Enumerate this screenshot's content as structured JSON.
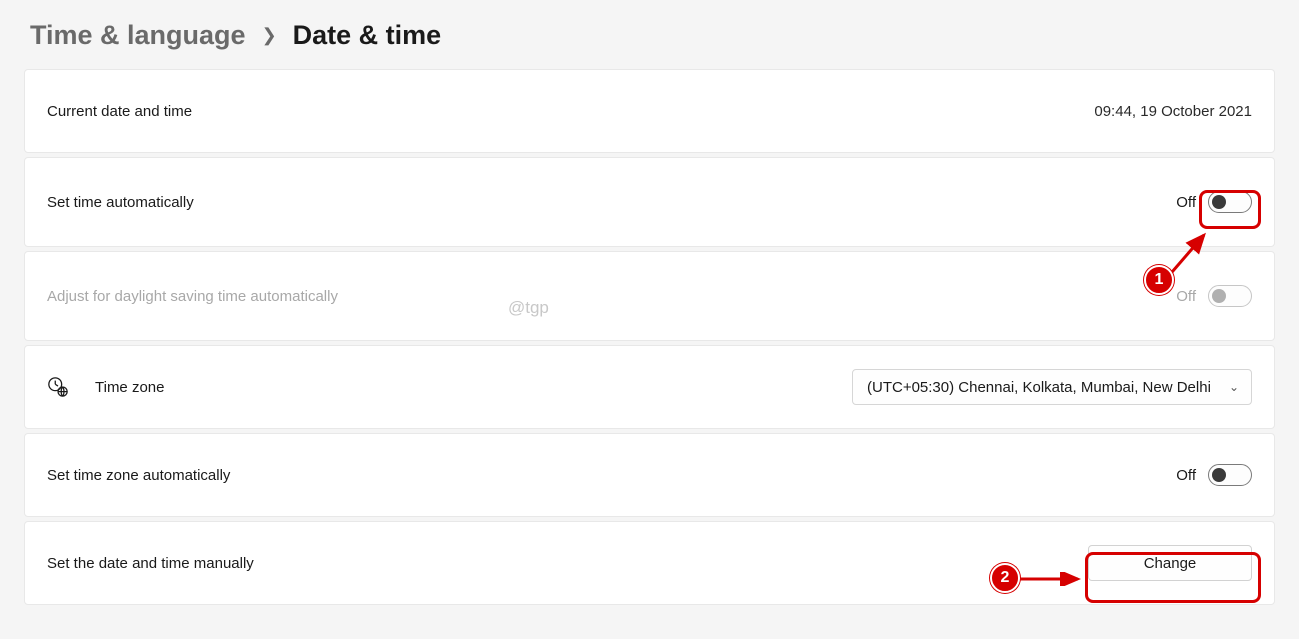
{
  "breadcrumb": {
    "parent": "Time & language",
    "current": "Date & time"
  },
  "rows": {
    "current": {
      "label": "Current date and time",
      "value": "09:44, 19 October 2021"
    },
    "autoTime": {
      "label": "Set time automatically",
      "state": "Off"
    },
    "dst": {
      "label": "Adjust for daylight saving time automatically",
      "state": "Off"
    },
    "timezone": {
      "label": "Time zone",
      "value": "(UTC+05:30) Chennai, Kolkata, Mumbai, New Delhi"
    },
    "autoTz": {
      "label": "Set time zone automatically",
      "state": "Off"
    },
    "manual": {
      "label": "Set the date and time manually",
      "button": "Change"
    }
  },
  "annotations": {
    "badge1": "1",
    "badge2": "2"
  },
  "watermark": "@tgp"
}
